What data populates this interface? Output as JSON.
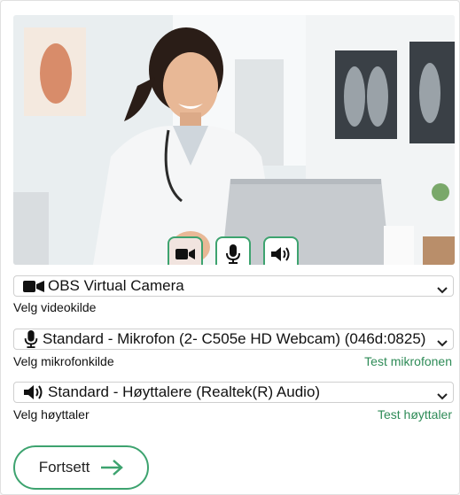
{
  "video": {
    "controls": [
      {
        "icon": "video-camera-icon",
        "active": true
      },
      {
        "icon": "microphone-icon",
        "active": false
      },
      {
        "icon": "speaker-icon",
        "active": false
      }
    ]
  },
  "camera": {
    "selected": "OBS Virtual Camera",
    "label": "Velg videokilde"
  },
  "microphone": {
    "selected": "Standard - Mikrofon (2- C505e HD Webcam) (046d:0825)",
    "label": "Velg mikrofonkilde",
    "test_link": "Test mikrofonen"
  },
  "speaker": {
    "selected": "Standard - Høyttalere (Realtek(R) Audio)",
    "label": "Velg høyttaler",
    "test_link": "Test høyttaler"
  },
  "continue_button": {
    "label": "Fortsett"
  },
  "colors": {
    "accent": "#3da36f",
    "link": "#2e8b57"
  }
}
